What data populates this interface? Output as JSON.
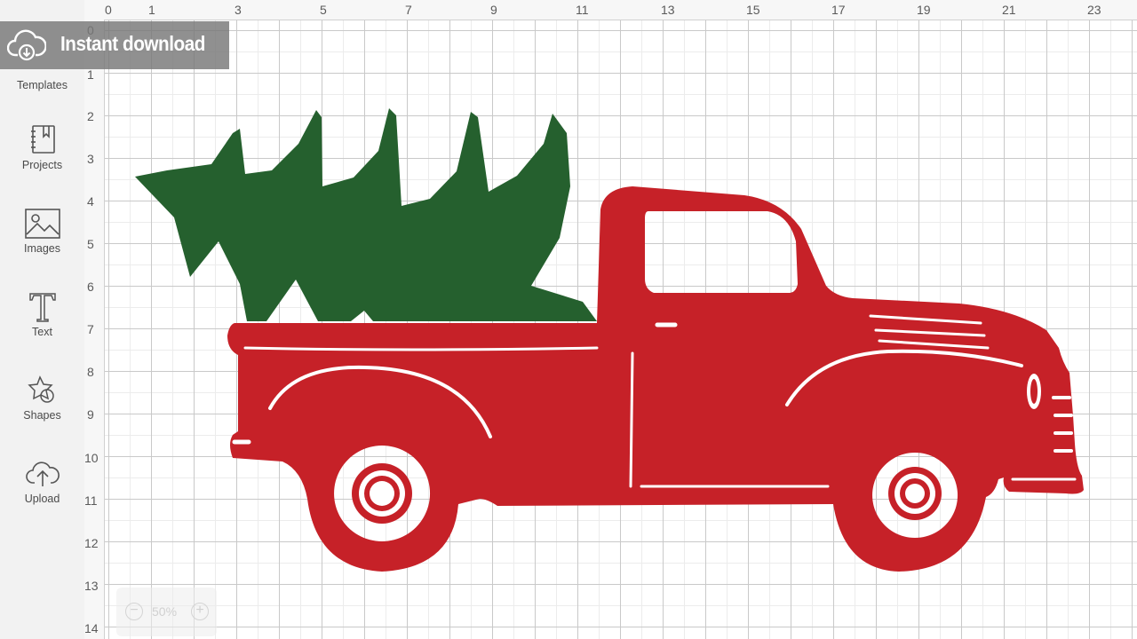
{
  "banner": {
    "text": "Instant download",
    "icon": "cloud-download-icon"
  },
  "sidebar": {
    "items": [
      {
        "label": "Templates",
        "icon": "templates-icon"
      },
      {
        "label": "Projects",
        "icon": "projects-icon"
      },
      {
        "label": "Images",
        "icon": "images-icon"
      },
      {
        "label": "Text",
        "icon": "text-icon"
      },
      {
        "label": "Shapes",
        "icon": "shapes-icon"
      },
      {
        "label": "Upload",
        "icon": "upload-icon"
      }
    ]
  },
  "ruler": {
    "top": [
      "0",
      "1",
      "3",
      "5",
      "7",
      "9",
      "11",
      "13",
      "15",
      "17",
      "19",
      "21",
      "23"
    ],
    "left": [
      "0",
      "1",
      "2",
      "3",
      "4",
      "5",
      "6",
      "7",
      "8",
      "9",
      "10",
      "11",
      "12",
      "13",
      "14"
    ]
  },
  "zoom": {
    "minus": "−",
    "value": "50%",
    "plus": "+"
  },
  "colors": {
    "truck": "#c62128",
    "tree": "#25602e",
    "grid": "#c9c9c9",
    "sidebar_bg": "#f2f2f2",
    "banner_bg": "#787878"
  }
}
